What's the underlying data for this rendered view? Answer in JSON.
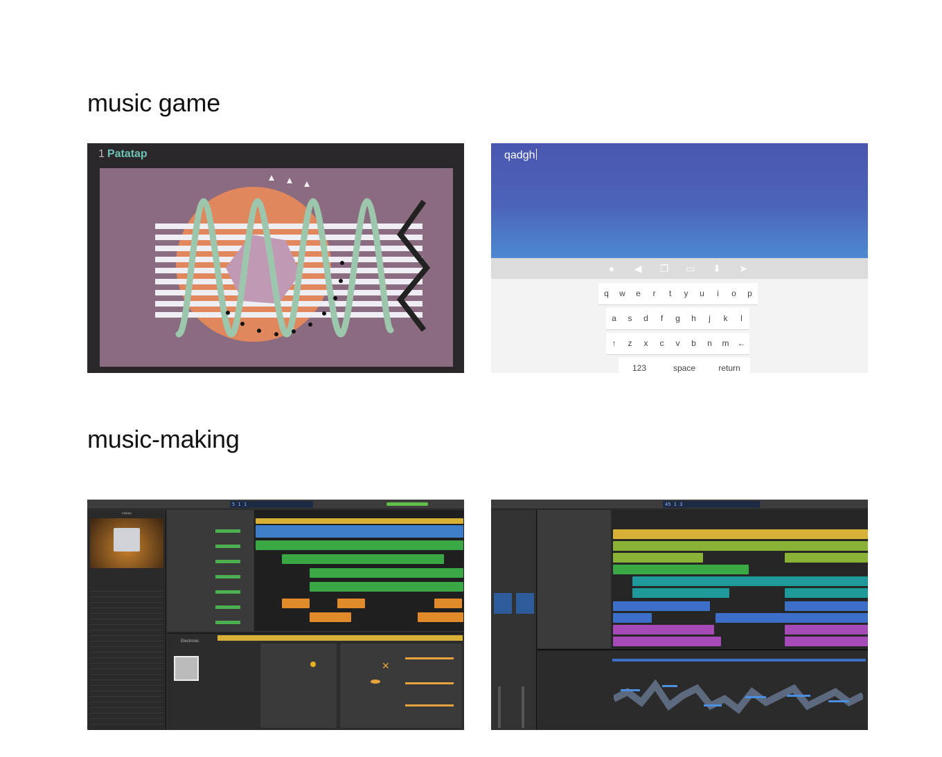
{
  "sections": {
    "music_game": "music game",
    "music_making": "music-making"
  },
  "patatap": {
    "number": "1",
    "name": "Patatap"
  },
  "keyboard_app": {
    "typed_text": "qadgh",
    "row1": [
      "q",
      "w",
      "e",
      "r",
      "t",
      "y",
      "u",
      "i",
      "o",
      "p"
    ],
    "row2": [
      "a",
      "s",
      "d",
      "f",
      "g",
      "h",
      "j",
      "k",
      "l"
    ],
    "row3": [
      "↑",
      "z",
      "x",
      "c",
      "v",
      "b",
      "n",
      "m",
      "←"
    ],
    "row4": [
      "123",
      "space",
      "return"
    ]
  },
  "garageband": {
    "library_label": "Library",
    "patch_category": "Electronic",
    "lcd_text": "5 1 1"
  },
  "logic": {
    "lcd_text": "45 1 3"
  },
  "colors": {
    "patatap_bg": "#8a6b7f",
    "wave": "#9cc7ad",
    "sun": "#e0875e",
    "hexagon": "#c09ab4",
    "keyboard_top": "#4a56b0",
    "region_yellow": "#d6b136",
    "region_green": "#39a845",
    "region_blue": "#3d7ec8",
    "region_orange": "#e08a2a",
    "region_teal": "#1f9a9a",
    "region_purple": "#a64ab8"
  }
}
